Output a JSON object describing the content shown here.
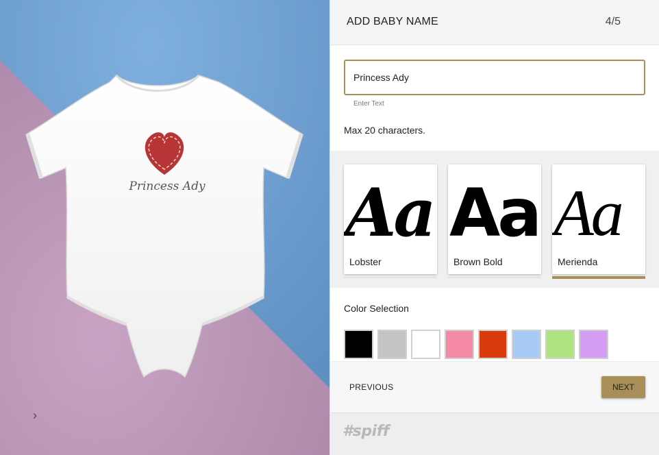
{
  "preview": {
    "printed_name": "Princess Ady",
    "arrow_glyph": "›",
    "colors": {
      "blue": "#6e9fcf",
      "pink": "#c59ebf",
      "heart": "#b73535"
    }
  },
  "panel": {
    "title": "ADD BABY NAME",
    "step": "4/5",
    "input_value": "Princess Ady",
    "input_hint": "Enter Text",
    "max_note": "Max 20 characters.",
    "accent_color": "#a88e57"
  },
  "fonts": [
    {
      "sample": "Aa",
      "name": "Lobster",
      "selected": false
    },
    {
      "sample": "Aa",
      "name": "Brown Bold",
      "selected": false
    },
    {
      "sample": "Aa",
      "name": "Merienda",
      "selected": true
    }
  ],
  "color_selection": {
    "title": "Color Selection",
    "swatches": [
      "#000000",
      "#c4c4c4",
      "#ffffff",
      "#f48aa4",
      "#d93a0e",
      "#a8cbf6",
      "#afe480",
      "#d69df5"
    ]
  },
  "nav": {
    "previous_label": "PREVIOUS",
    "next_label": "NEXT"
  },
  "footer": {
    "brand": "#spiff"
  }
}
